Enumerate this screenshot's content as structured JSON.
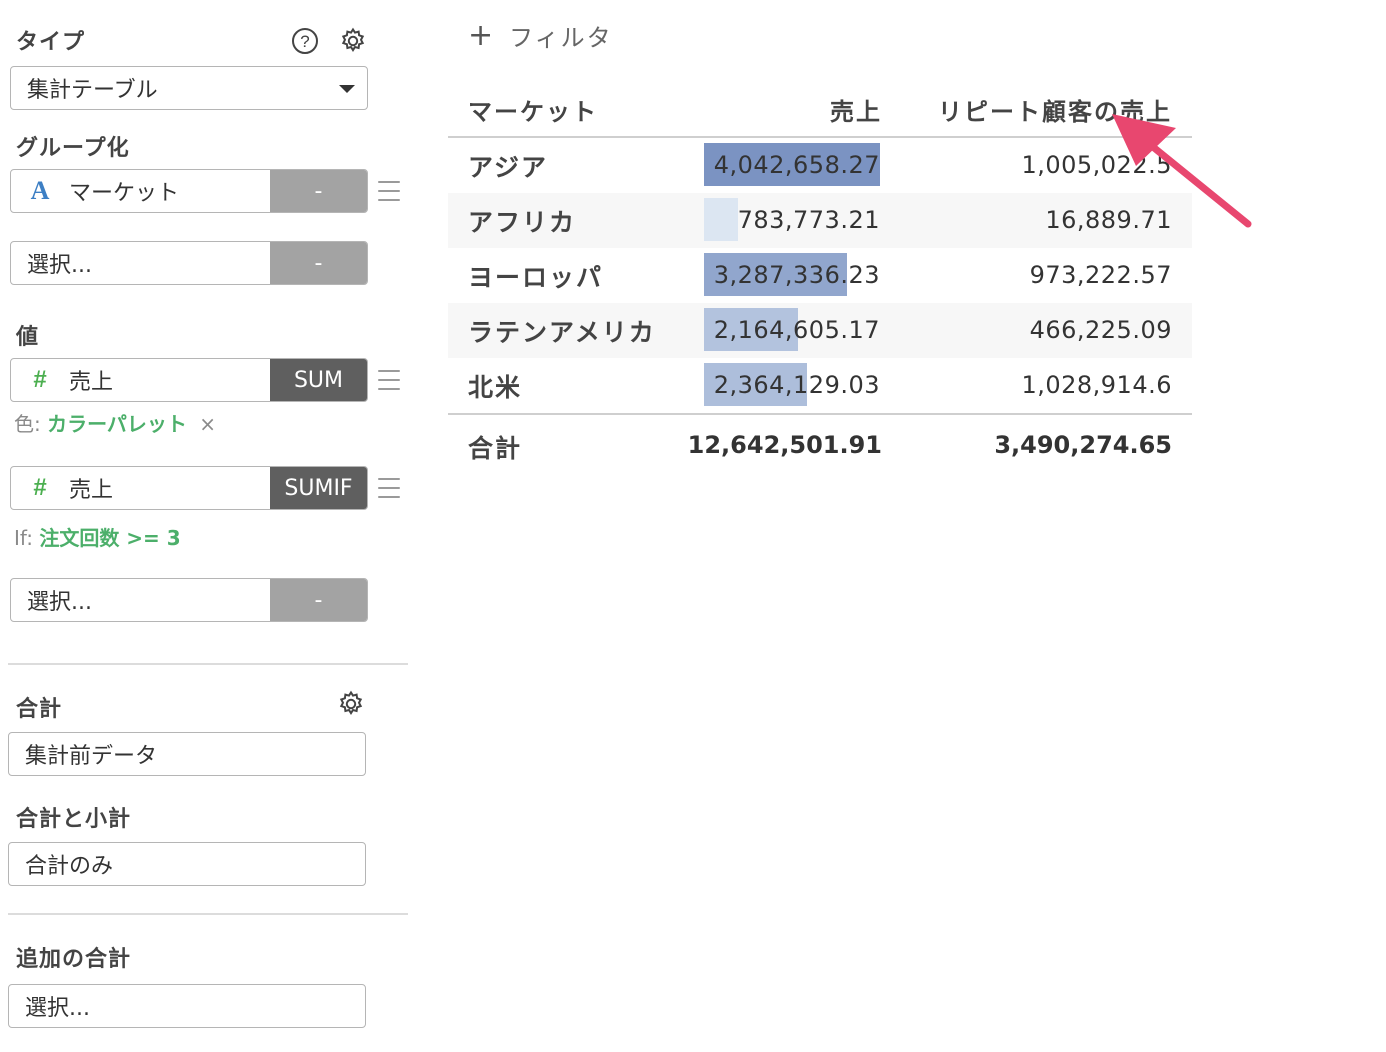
{
  "sidebar": {
    "type_section": {
      "label": "タイプ",
      "help_icon": "question-circle-icon",
      "settings_icon": "gear-icon",
      "selected": "集計テーブル"
    },
    "group_section": {
      "label": "グループ化",
      "items": [
        {
          "type_icon": "A",
          "name": "マーケット",
          "action": "-"
        },
        {
          "type_icon": "",
          "name": "選択...",
          "action": "-"
        }
      ]
    },
    "value_section": {
      "label": "値",
      "items": [
        {
          "type_icon": "#",
          "name": "売上",
          "action": "SUM",
          "note_prefix": "色:",
          "note_value": "カラーパレット",
          "note_remove": "×"
        },
        {
          "type_icon": "#",
          "name": "売上",
          "action": "SUMIF",
          "note_prefix": "If:",
          "note_value": "注文回数 >= 3"
        },
        {
          "type_icon": "",
          "name": "選択...",
          "action": "-"
        }
      ]
    },
    "total_section": {
      "label": "合計",
      "settings_icon": "gear-icon",
      "selected": "集計前データ"
    },
    "subtotal_section": {
      "label": "合計と小計",
      "selected": "合計のみ"
    },
    "additional_total_section": {
      "label": "追加の合計",
      "selected": "選択..."
    }
  },
  "filter": {
    "label": "フィルタ",
    "icon": "plus-icon"
  },
  "table": {
    "headers": {
      "market": "マーケット",
      "sales": "売上",
      "repeat_sales": "リピート顧客の売上"
    },
    "rows": [
      {
        "market": "アジア",
        "sales": "4,042,658.27",
        "sales_value": 4042658.27,
        "repeat_sales": "1,005,022.5"
      },
      {
        "market": "アフリカ",
        "sales": "783,773.21",
        "sales_value": 783773.21,
        "repeat_sales": "16,889.71"
      },
      {
        "market": "ヨーロッパ",
        "sales": "3,287,336.23",
        "sales_value": 3287336.23,
        "repeat_sales": "973,222.57"
      },
      {
        "market": "ラテンアメリカ",
        "sales": "2,164,605.17",
        "sales_value": 2164605.17,
        "repeat_sales": "466,225.09"
      },
      {
        "market": "北米",
        "sales": "2,364,129.03",
        "sales_value": 2364129.03,
        "repeat_sales": "1,028,914.6"
      }
    ],
    "total": {
      "label": "合計",
      "sales": "12,642,501.91",
      "repeat_sales": "3,490,274.65"
    },
    "bar_colors": {
      "max": "#7b93c2",
      "min": "#dce6f2"
    }
  },
  "annotation": {
    "arrow_color": "#e8476f",
    "icon": "arrow-annotation"
  }
}
